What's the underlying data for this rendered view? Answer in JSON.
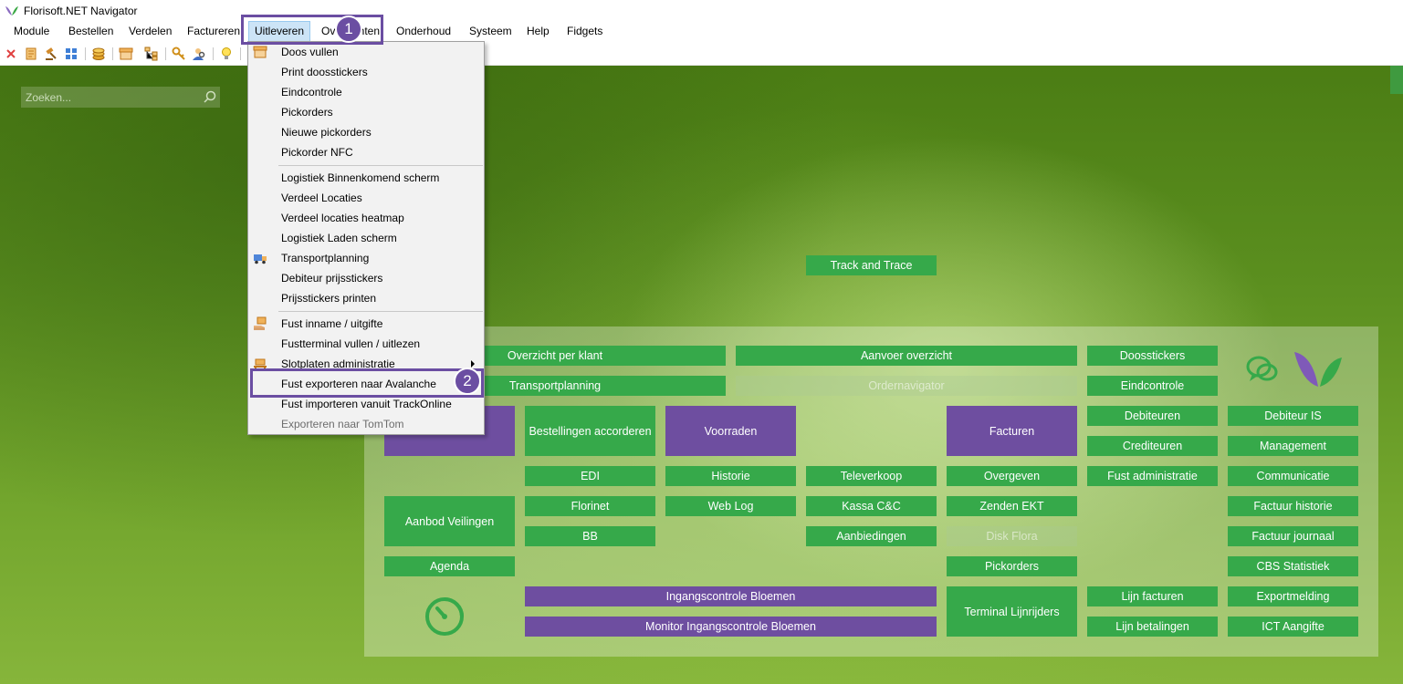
{
  "window": {
    "title": "Florisoft.NET Navigator"
  },
  "menubar": {
    "items": [
      "Module",
      "Bestellen",
      "Verdelen",
      "Factureren",
      "Uitleveren",
      "Overzichten",
      "Onderhoud",
      "Systeem",
      "Help",
      "Fidgets"
    ],
    "active_index": 4
  },
  "toolbar": {
    "icons": [
      "close-icon",
      "document-icon",
      "gavel-icon",
      "grid-icon",
      "coins-icon",
      "box-icon",
      "tree-icon",
      "key-icon",
      "user-search-icon",
      "lightbulb-icon"
    ]
  },
  "search": {
    "placeholder": "Zoeken..."
  },
  "dropdown": {
    "items": [
      {
        "label": "Doos vullen",
        "icon": "box-icon"
      },
      {
        "label": "Print doosstickers"
      },
      {
        "label": "Eindcontrole"
      },
      {
        "label": "Pickorders"
      },
      {
        "label": "Nieuwe pickorders"
      },
      {
        "label": "Pickorder NFC"
      },
      {
        "label": "Logistiek Binnenkomend scherm"
      },
      {
        "label": "Verdeel Locaties"
      },
      {
        "label": "Verdeel locaties heatmap"
      },
      {
        "label": "Logistiek Laden scherm"
      },
      {
        "label": "Transportplanning",
        "icon": "truck-icon"
      },
      {
        "label": "Debiteur prijsstickers"
      },
      {
        "label": "Prijsstickers printen"
      },
      {
        "label": "Fust inname / uitgifte",
        "icon": "hand-box-icon"
      },
      {
        "label": "Fustterminal vullen / uitlezen"
      },
      {
        "label": "Slotplaten administratie",
        "icon": "pallet-icon",
        "submenu": true
      },
      {
        "label": "Fust exporteren naar Avalanche"
      },
      {
        "label": "Fust importeren vanuit TrackOnline"
      },
      {
        "label": "Exporteren naar TomTom",
        "disabled": true
      }
    ]
  },
  "tiles": {
    "track_and_trace": "Track and Trace",
    "overzicht_per_klant": "Overzicht per klant",
    "aanvoer_overzicht": "Aanvoer overzicht",
    "doosstickers": "Doosstickers",
    "transportplanning": "Transportplanning",
    "ordernavigator": "Ordernavigator",
    "eindcontrole": "Eindcontrole",
    "bestellingen_accorderen": "Bestellingen accorderen",
    "voorraden": "Voorraden",
    "facturen": "Facturen",
    "debiteuren": "Debiteuren",
    "debiteur_is": "Debiteur IS",
    "crediteuren": "Crediteuren",
    "management": "Management",
    "edi": "EDI",
    "historie": "Historie",
    "televerkoop": "Televerkoop",
    "overgeven": "Overgeven",
    "fust_administratie": "Fust administratie",
    "communicatie": "Communicatie",
    "aanbod_veilingen": "Aanbod Veilingen",
    "florinet": "Florinet",
    "web_log": "Web Log",
    "kassa_cc": "Kassa C&C",
    "zenden_ekt": "Zenden EKT",
    "factuur_historie": "Factuur historie",
    "bb": "BB",
    "aanbiedingen": "Aanbiedingen",
    "disk_flora": "Disk Flora",
    "factuur_journaal": "Factuur journaal",
    "agenda": "Agenda",
    "pickorders": "Pickorders",
    "cbs_statistiek": "CBS Statistiek",
    "ingangscontrole_bloemen": "Ingangscontrole Bloemen",
    "terminal_lijnrijders": "Terminal Lijnrijders",
    "lijn_facturen": "Lijn facturen",
    "exportmelding": "Exportmelding",
    "monitor_ingangscontrole_bloemen": "Monitor Ingangscontrole Bloemen",
    "lijn_betalingen": "Lijn betalingen",
    "ict_aangifte": "ICT Aangifte"
  },
  "annotations": {
    "step1": "1",
    "step2": "2"
  },
  "colors": {
    "tile_green": "#36a94a",
    "tile_purple": "#6e4ea0",
    "highlight": "#6b4ea2"
  }
}
